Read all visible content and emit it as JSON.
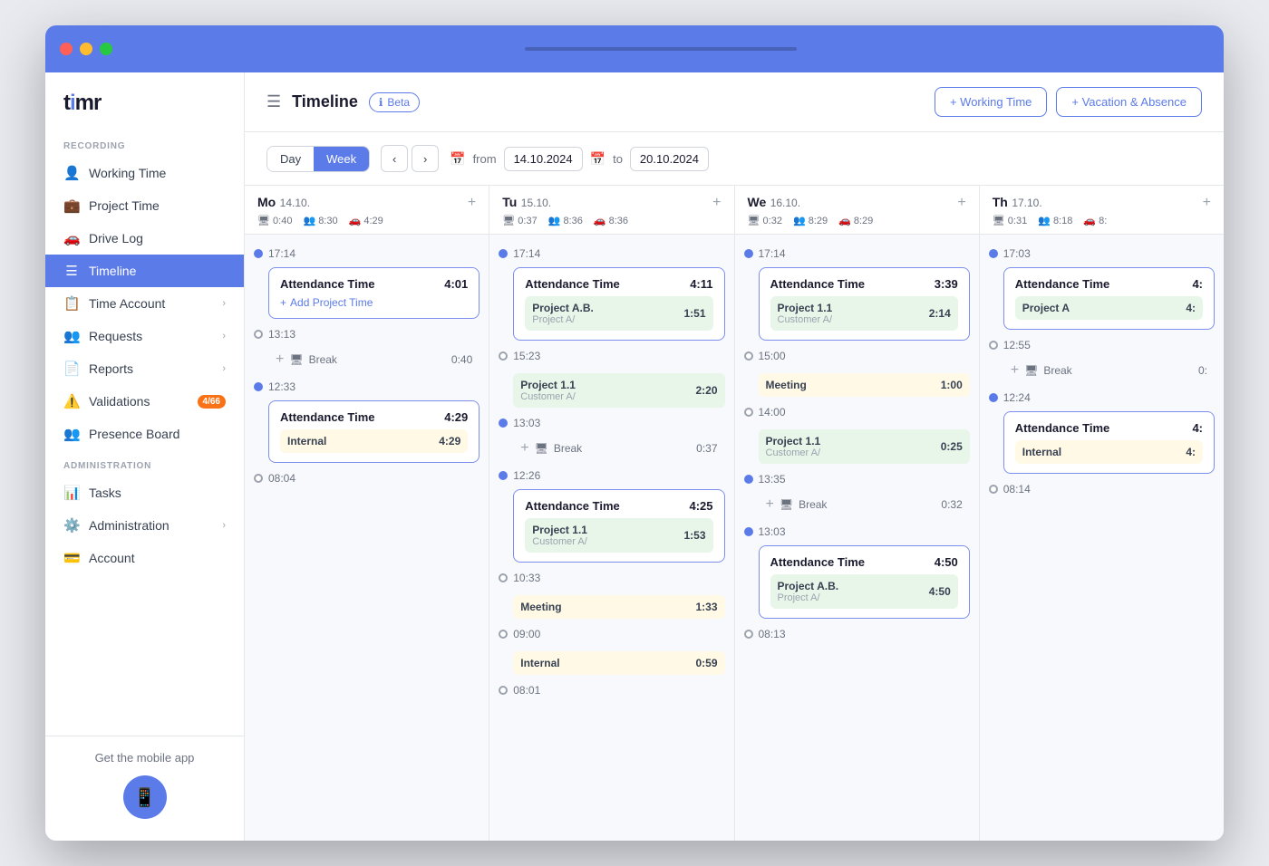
{
  "app": {
    "logo": "timr",
    "logo_dot": "i"
  },
  "sidebar": {
    "recording_label": "RECORDING",
    "administration_label": "ADMINISTRATION",
    "items": [
      {
        "id": "working-time",
        "label": "Working Time",
        "icon": "👤",
        "active": false
      },
      {
        "id": "project-time",
        "label": "Project Time",
        "icon": "🚗",
        "active": false
      },
      {
        "id": "drive-log",
        "label": "Drive Log",
        "icon": "🚗",
        "active": false
      },
      {
        "id": "timeline",
        "label": "Timeline",
        "icon": "☰",
        "active": true
      },
      {
        "id": "time-account",
        "label": "Time Account",
        "icon": "📋",
        "active": false,
        "has_chevron": true
      },
      {
        "id": "requests",
        "label": "Requests",
        "icon": "👥",
        "active": false,
        "has_chevron": true
      },
      {
        "id": "reports",
        "label": "Reports",
        "icon": "📄",
        "active": false,
        "has_chevron": true
      },
      {
        "id": "validations",
        "label": "Validations",
        "icon": "⚠️",
        "active": false,
        "badge": "4/66"
      },
      {
        "id": "presence-board",
        "label": "Presence Board",
        "icon": "👥",
        "active": false
      },
      {
        "id": "tasks",
        "label": "Tasks",
        "icon": "📊",
        "active": false
      },
      {
        "id": "administration",
        "label": "Administration",
        "icon": "⚙️",
        "active": false,
        "has_chevron": true
      },
      {
        "id": "account",
        "label": "Account",
        "icon": "💳",
        "active": false
      }
    ],
    "footer": {
      "get_app": "Get the mobile app"
    }
  },
  "header": {
    "title": "Timeline",
    "beta_label": "Beta",
    "btn_working_time": "+ Working Time",
    "btn_vacation": "+ Vacation & Absence"
  },
  "toolbar": {
    "view_day": "Day",
    "view_week": "Week",
    "from_label": "from",
    "to_label": "to",
    "from_date": "14.10.2024",
    "to_date": "20.10.2024"
  },
  "days": [
    {
      "name": "Mo",
      "date": "14.10.",
      "stats": [
        {
          "icon": "🖥",
          "value": "0:40"
        },
        {
          "icon": "👥",
          "value": "8:30"
        },
        {
          "icon": "🚗",
          "value": "4:29"
        }
      ],
      "events": [
        {
          "type": "time",
          "time": "17:14",
          "filled": true
        },
        {
          "type": "attendance",
          "title": "Attendance Time",
          "duration": "4:01",
          "projects": [],
          "add_link": "+ Add Project Time"
        },
        {
          "type": "time",
          "time": "13:13",
          "filled": false
        },
        {
          "type": "break",
          "duration": "0:40"
        },
        {
          "type": "time",
          "time": "12:33",
          "filled": true
        },
        {
          "type": "attendance",
          "title": "Attendance Time",
          "duration": "4:29",
          "projects": [
            {
              "name": "Internal",
              "sub": "",
              "duration": "4:29",
              "color": "yellow"
            }
          ]
        },
        {
          "type": "time",
          "time": "08:04",
          "filled": false
        }
      ]
    },
    {
      "name": "Tu",
      "date": "15.10.",
      "stats": [
        {
          "icon": "🖥",
          "value": "0:37"
        },
        {
          "icon": "👥",
          "value": "8:36"
        },
        {
          "icon": "🚗",
          "value": "8:36"
        }
      ],
      "events": [
        {
          "type": "time",
          "time": "17:14",
          "filled": true
        },
        {
          "type": "attendance",
          "title": "Attendance Time",
          "duration": "4:11",
          "projects": [
            {
              "name": "Project A.B.",
              "sub": "Project A/",
              "duration": "1:51",
              "color": "green"
            }
          ]
        },
        {
          "type": "time",
          "time": "15:23",
          "filled": false
        },
        {
          "type": "attendance_sub",
          "projects": [
            {
              "name": "Project 1.1",
              "sub": "Customer A/",
              "duration": "2:20",
              "color": "green"
            }
          ]
        },
        {
          "type": "time",
          "time": "13:03",
          "filled": true
        },
        {
          "type": "break",
          "duration": "0:37"
        },
        {
          "type": "time",
          "time": "12:26",
          "filled": true
        },
        {
          "type": "attendance",
          "title": "Attendance Time",
          "duration": "4:25",
          "projects": [
            {
              "name": "Project 1.1",
              "sub": "Customer A/",
              "duration": "1:53",
              "color": "green"
            }
          ]
        },
        {
          "type": "time",
          "time": "10:33",
          "filled": false
        },
        {
          "type": "attendance_sub",
          "projects": [
            {
              "name": "Meeting",
              "sub": "",
              "duration": "1:33",
              "color": "yellow"
            }
          ]
        },
        {
          "type": "time",
          "time": "09:00",
          "filled": false
        },
        {
          "type": "attendance_sub",
          "projects": [
            {
              "name": "Internal",
              "sub": "",
              "duration": "0:59",
              "color": "yellow"
            }
          ]
        },
        {
          "type": "time",
          "time": "08:01",
          "filled": false
        }
      ]
    },
    {
      "name": "We",
      "date": "16.10.",
      "stats": [
        {
          "icon": "🖥",
          "value": "0:32"
        },
        {
          "icon": "👥",
          "value": "8:29"
        },
        {
          "icon": "🚗",
          "value": "8:29"
        }
      ],
      "events": [
        {
          "type": "time",
          "time": "17:14",
          "filled": true
        },
        {
          "type": "attendance",
          "title": "Attendance Time",
          "duration": "3:39",
          "projects": [
            {
              "name": "Project 1.1",
              "sub": "Customer A/",
              "duration": "2:14",
              "color": "green"
            }
          ]
        },
        {
          "type": "time",
          "time": "15:00",
          "filled": false
        },
        {
          "type": "attendance_sub",
          "projects": [
            {
              "name": "Meeting",
              "sub": "",
              "duration": "1:00",
              "color": "yellow"
            }
          ]
        },
        {
          "type": "time",
          "time": "14:00",
          "filled": false
        },
        {
          "type": "attendance_sub",
          "projects": [
            {
              "name": "Project 1.1",
              "sub": "Customer A/",
              "duration": "0:25",
              "color": "green"
            }
          ]
        },
        {
          "type": "time",
          "time": "13:35",
          "filled": true
        },
        {
          "type": "break",
          "duration": "0:32"
        },
        {
          "type": "time",
          "time": "13:03",
          "filled": true
        },
        {
          "type": "attendance",
          "title": "Attendance Time",
          "duration": "4:50",
          "projects": [
            {
              "name": "Project A.B.",
              "sub": "Project A/",
              "duration": "4:50",
              "color": "green"
            }
          ]
        },
        {
          "type": "time",
          "time": "08:13",
          "filled": false
        }
      ]
    },
    {
      "name": "Th",
      "date": "17.10.",
      "stats": [
        {
          "icon": "🖥",
          "value": "0:31"
        },
        {
          "icon": "👥",
          "value": "8:18"
        },
        {
          "icon": "🚗",
          "value": "8:"
        }
      ],
      "events": [
        {
          "type": "time",
          "time": "17:03",
          "filled": true
        },
        {
          "type": "attendance",
          "title": "Attendance Time",
          "duration": "4:",
          "projects": [
            {
              "name": "Project A",
              "sub": "",
              "duration": "4:",
              "color": "green"
            }
          ]
        },
        {
          "type": "time",
          "time": "12:55",
          "filled": false
        },
        {
          "type": "break",
          "duration": "0:"
        },
        {
          "type": "time",
          "time": "12:24",
          "filled": true
        },
        {
          "type": "attendance",
          "title": "Attendance Time",
          "duration": "4:",
          "projects": [
            {
              "name": "Internal",
              "sub": "",
              "duration": "4:",
              "color": "yellow"
            }
          ]
        },
        {
          "type": "time",
          "time": "08:14",
          "filled": false
        }
      ]
    }
  ],
  "tooltip": {
    "attendance_project_a": "Attendance Time Project A",
    "break": "Break"
  }
}
